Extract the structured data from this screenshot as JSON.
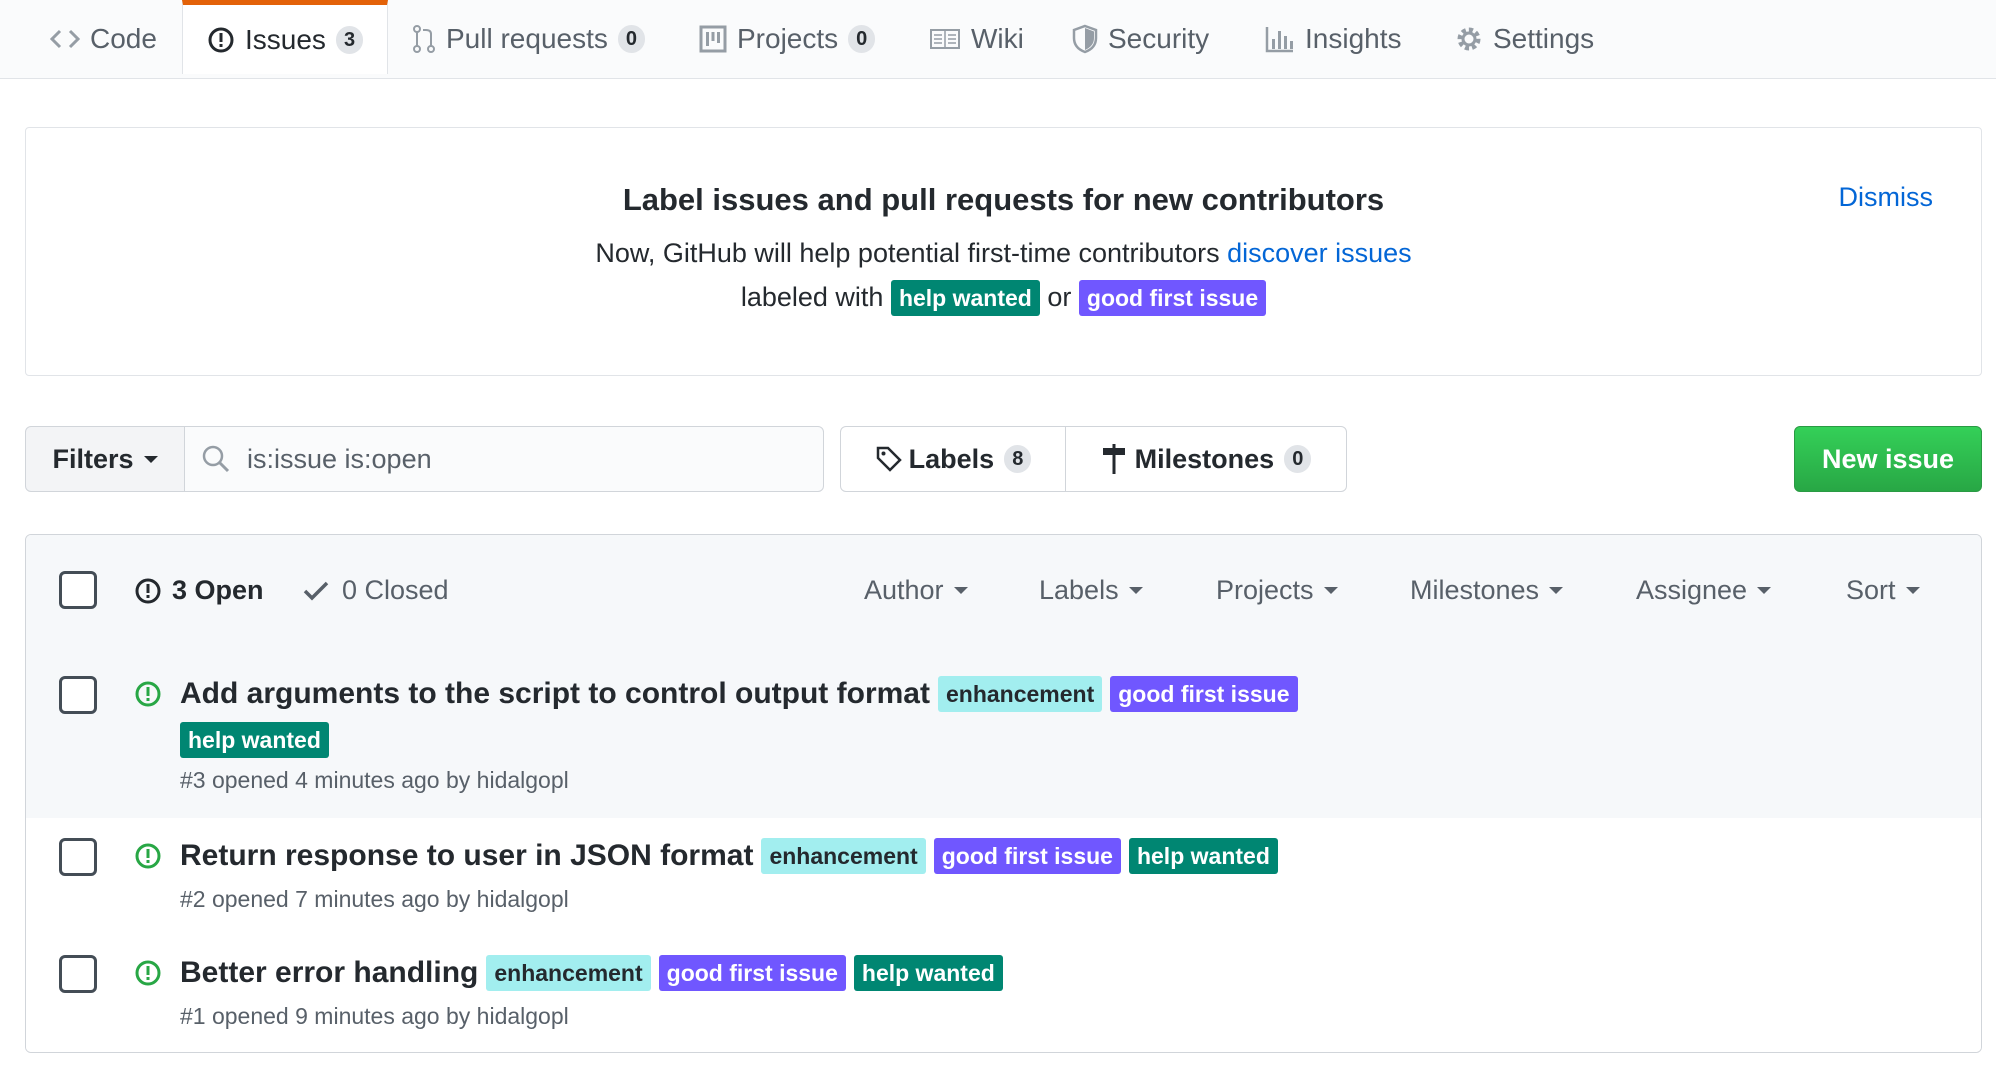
{
  "tabs": [
    {
      "label": "Code",
      "icon": "code-icon"
    },
    {
      "label": "Issues",
      "count": "3",
      "icon": "issue-opened-icon"
    },
    {
      "label": "Pull requests",
      "count": "0",
      "icon": "git-pull-request-icon"
    },
    {
      "label": "Projects",
      "count": "0",
      "icon": "project-icon"
    },
    {
      "label": "Wiki",
      "icon": "book-icon"
    },
    {
      "label": "Security",
      "icon": "shield-icon"
    },
    {
      "label": "Insights",
      "icon": "graph-icon"
    },
    {
      "label": "Settings",
      "icon": "gear-icon"
    }
  ],
  "banner": {
    "title": "Label issues and pull requests for new contributors",
    "line1_prefix": "Now, GitHub will help potential first-time contributors",
    "line1_link": "discover issues",
    "line2_prefix": "labeled with",
    "line2_or": "or",
    "label_help": "help wanted",
    "label_good": "good first issue",
    "dismiss": "Dismiss"
  },
  "filters": {
    "button": "Filters",
    "search_value": "is:issue is:open",
    "labels_label": "Labels",
    "labels_count": "8",
    "milestones_label": "Milestones",
    "milestones_count": "0",
    "new_issue": "New issue"
  },
  "list_header": {
    "open": "3 Open",
    "closed": "0 Closed",
    "author": "Author",
    "labels": "Labels",
    "projects": "Projects",
    "milestones": "Milestones",
    "assignee": "Assignee",
    "sort": "Sort"
  },
  "issues": [
    {
      "title": "Add arguments to the script to control output format",
      "labels": [
        "enhancement",
        "good first issue",
        "help wanted"
      ],
      "meta": "#3 opened 4 minutes ago by hidalgopl"
    },
    {
      "title": "Return response to user in JSON format",
      "labels": [
        "enhancement",
        "good first issue",
        "help wanted"
      ],
      "meta": "#2 opened 7 minutes ago by hidalgopl"
    },
    {
      "title": "Better error handling",
      "labels": [
        "enhancement",
        "good first issue",
        "help wanted"
      ],
      "meta": "#1 opened 9 minutes ago by hidalgopl"
    }
  ],
  "colors": {
    "help_wanted": "#008672",
    "good_first_issue": "#7057ff",
    "enhancement": "#a2eeef",
    "open_issue_icon": "#28a745",
    "primary_button": "#28a745",
    "link": "#0366d6",
    "selected_tab_accent": "#e36209"
  }
}
